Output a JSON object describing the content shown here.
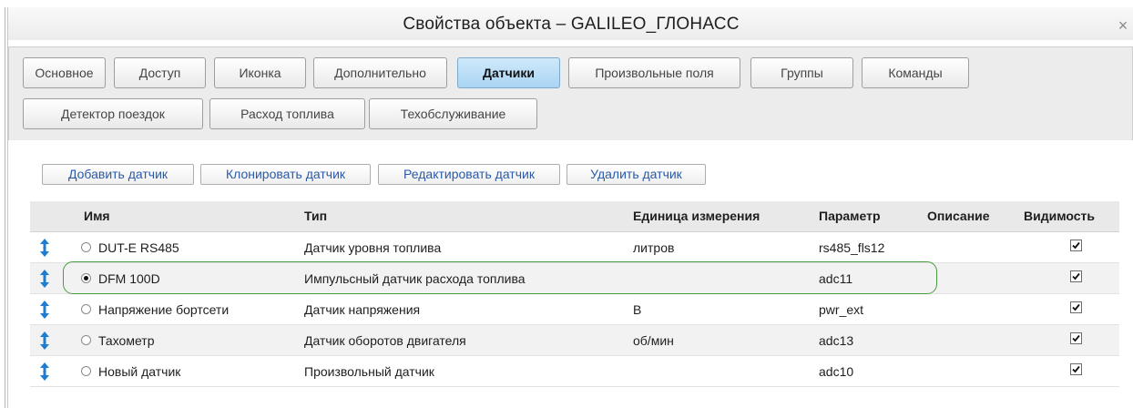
{
  "dialog": {
    "title": "Свойства объекта – GALILEO_ГЛОНАСС",
    "close_symbol": "×"
  },
  "tabs": [
    {
      "label": "Основное",
      "active": false
    },
    {
      "label": "Доступ",
      "active": false
    },
    {
      "label": "Иконка",
      "active": false
    },
    {
      "label": "Дополнительно",
      "active": false
    },
    {
      "label": "Датчики",
      "active": true
    },
    {
      "label": "Произвольные поля",
      "active": false
    },
    {
      "label": "Группы",
      "active": false
    },
    {
      "label": "Команды",
      "active": false
    },
    {
      "label": "Детектор поездок",
      "active": false
    },
    {
      "label": "Расход топлива",
      "active": false
    },
    {
      "label": "Техобслуживание",
      "active": false
    }
  ],
  "actions": {
    "add": "Добавить датчик",
    "clone": "Клонировать датчик",
    "edit": "Редактировать датчик",
    "delete": "Удалить датчик"
  },
  "table": {
    "columns": {
      "name": "Имя",
      "type": "Тип",
      "unit": "Единица измерения",
      "param": "Параметр",
      "description": "Описание",
      "visibility": "Видимость"
    },
    "rows": [
      {
        "name": "DUT-E RS485",
        "type": "Датчик уровня топлива",
        "unit": "литров",
        "param": "rs485_fls12",
        "description": "",
        "selected": false,
        "visible": true
      },
      {
        "name": "DFM 100D",
        "type": "Импульсный датчик расхода топлива",
        "unit": "",
        "param": "adc11",
        "description": "",
        "selected": true,
        "visible": true
      },
      {
        "name": "Напряжение бортсети",
        "type": "Датчик напряжения",
        "unit": "В",
        "param": "pwr_ext",
        "description": "",
        "selected": false,
        "visible": true
      },
      {
        "name": "Тахометр",
        "type": "Датчик оборотов двигателя",
        "unit": "об/мин",
        "param": "adc13",
        "description": "",
        "selected": false,
        "visible": true
      },
      {
        "name": "Новый датчик",
        "type": "Произвольный датчик",
        "unit": "",
        "param": "adc10",
        "description": "",
        "selected": false,
        "visible": true
      }
    ]
  },
  "colors": {
    "active_tab": "#a9d4f3",
    "action_link": "#2a5aa8",
    "sort_icon": "#1f7ccf",
    "highlight": "#4c9a43"
  }
}
